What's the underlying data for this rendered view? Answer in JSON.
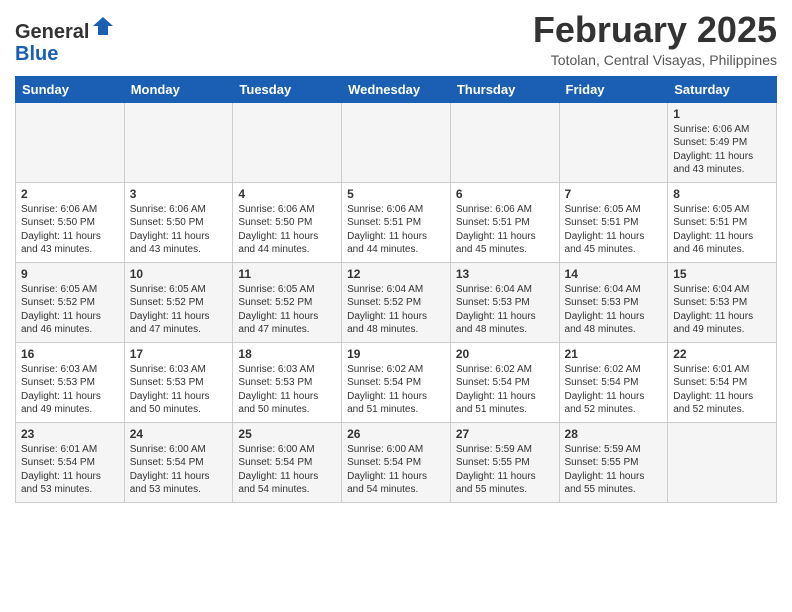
{
  "header": {
    "logo_general": "General",
    "logo_blue": "Blue",
    "month_title": "February 2025",
    "location": "Totolan, Central Visayas, Philippines"
  },
  "days_of_week": [
    "Sunday",
    "Monday",
    "Tuesday",
    "Wednesday",
    "Thursday",
    "Friday",
    "Saturday"
  ],
  "weeks": [
    {
      "days": [
        {
          "num": "",
          "info": ""
        },
        {
          "num": "",
          "info": ""
        },
        {
          "num": "",
          "info": ""
        },
        {
          "num": "",
          "info": ""
        },
        {
          "num": "",
          "info": ""
        },
        {
          "num": "",
          "info": ""
        },
        {
          "num": "1",
          "info": "Sunrise: 6:06 AM\nSunset: 5:49 PM\nDaylight: 11 hours\nand 43 minutes."
        }
      ]
    },
    {
      "days": [
        {
          "num": "2",
          "info": "Sunrise: 6:06 AM\nSunset: 5:50 PM\nDaylight: 11 hours\nand 43 minutes."
        },
        {
          "num": "3",
          "info": "Sunrise: 6:06 AM\nSunset: 5:50 PM\nDaylight: 11 hours\nand 43 minutes."
        },
        {
          "num": "4",
          "info": "Sunrise: 6:06 AM\nSunset: 5:50 PM\nDaylight: 11 hours\nand 44 minutes."
        },
        {
          "num": "5",
          "info": "Sunrise: 6:06 AM\nSunset: 5:51 PM\nDaylight: 11 hours\nand 44 minutes."
        },
        {
          "num": "6",
          "info": "Sunrise: 6:06 AM\nSunset: 5:51 PM\nDaylight: 11 hours\nand 45 minutes."
        },
        {
          "num": "7",
          "info": "Sunrise: 6:05 AM\nSunset: 5:51 PM\nDaylight: 11 hours\nand 45 minutes."
        },
        {
          "num": "8",
          "info": "Sunrise: 6:05 AM\nSunset: 5:51 PM\nDaylight: 11 hours\nand 46 minutes."
        }
      ]
    },
    {
      "days": [
        {
          "num": "9",
          "info": "Sunrise: 6:05 AM\nSunset: 5:52 PM\nDaylight: 11 hours\nand 46 minutes."
        },
        {
          "num": "10",
          "info": "Sunrise: 6:05 AM\nSunset: 5:52 PM\nDaylight: 11 hours\nand 47 minutes."
        },
        {
          "num": "11",
          "info": "Sunrise: 6:05 AM\nSunset: 5:52 PM\nDaylight: 11 hours\nand 47 minutes."
        },
        {
          "num": "12",
          "info": "Sunrise: 6:04 AM\nSunset: 5:52 PM\nDaylight: 11 hours\nand 48 minutes."
        },
        {
          "num": "13",
          "info": "Sunrise: 6:04 AM\nSunset: 5:53 PM\nDaylight: 11 hours\nand 48 minutes."
        },
        {
          "num": "14",
          "info": "Sunrise: 6:04 AM\nSunset: 5:53 PM\nDaylight: 11 hours\nand 48 minutes."
        },
        {
          "num": "15",
          "info": "Sunrise: 6:04 AM\nSunset: 5:53 PM\nDaylight: 11 hours\nand 49 minutes."
        }
      ]
    },
    {
      "days": [
        {
          "num": "16",
          "info": "Sunrise: 6:03 AM\nSunset: 5:53 PM\nDaylight: 11 hours\nand 49 minutes."
        },
        {
          "num": "17",
          "info": "Sunrise: 6:03 AM\nSunset: 5:53 PM\nDaylight: 11 hours\nand 50 minutes."
        },
        {
          "num": "18",
          "info": "Sunrise: 6:03 AM\nSunset: 5:53 PM\nDaylight: 11 hours\nand 50 minutes."
        },
        {
          "num": "19",
          "info": "Sunrise: 6:02 AM\nSunset: 5:54 PM\nDaylight: 11 hours\nand 51 minutes."
        },
        {
          "num": "20",
          "info": "Sunrise: 6:02 AM\nSunset: 5:54 PM\nDaylight: 11 hours\nand 51 minutes."
        },
        {
          "num": "21",
          "info": "Sunrise: 6:02 AM\nSunset: 5:54 PM\nDaylight: 11 hours\nand 52 minutes."
        },
        {
          "num": "22",
          "info": "Sunrise: 6:01 AM\nSunset: 5:54 PM\nDaylight: 11 hours\nand 52 minutes."
        }
      ]
    },
    {
      "days": [
        {
          "num": "23",
          "info": "Sunrise: 6:01 AM\nSunset: 5:54 PM\nDaylight: 11 hours\nand 53 minutes."
        },
        {
          "num": "24",
          "info": "Sunrise: 6:00 AM\nSunset: 5:54 PM\nDaylight: 11 hours\nand 53 minutes."
        },
        {
          "num": "25",
          "info": "Sunrise: 6:00 AM\nSunset: 5:54 PM\nDaylight: 11 hours\nand 54 minutes."
        },
        {
          "num": "26",
          "info": "Sunrise: 6:00 AM\nSunset: 5:54 PM\nDaylight: 11 hours\nand 54 minutes."
        },
        {
          "num": "27",
          "info": "Sunrise: 5:59 AM\nSunset: 5:55 PM\nDaylight: 11 hours\nand 55 minutes."
        },
        {
          "num": "28",
          "info": "Sunrise: 5:59 AM\nSunset: 5:55 PM\nDaylight: 11 hours\nand 55 minutes."
        },
        {
          "num": "",
          "info": ""
        }
      ]
    }
  ]
}
